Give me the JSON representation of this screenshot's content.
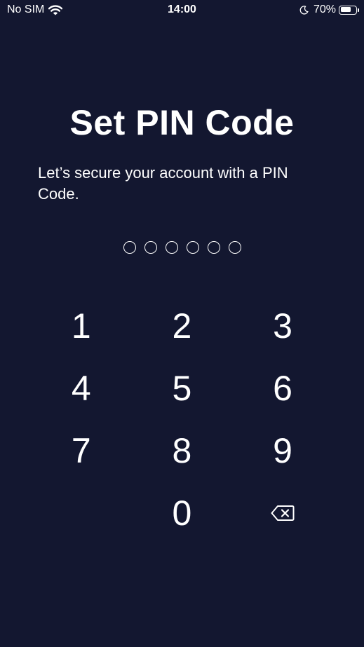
{
  "status_bar": {
    "carrier": "No SIM",
    "time": "14:00",
    "battery_percent": "70%",
    "battery_level": 0.7
  },
  "screen": {
    "title": "Set PIN Code",
    "subtitle": "Let’s secure your account with a PIN Code.",
    "pin_length": 6,
    "pin_filled": 0
  },
  "keypad": {
    "keys": [
      "1",
      "2",
      "3",
      "4",
      "5",
      "6",
      "7",
      "8",
      "9",
      "",
      "0",
      "backspace"
    ]
  },
  "colors": {
    "background": "#131730",
    "text": "#ffffff"
  },
  "icons": {
    "wifi": "wifi-icon",
    "moon": "moon-icon",
    "battery": "battery-icon",
    "backspace": "backspace-icon"
  }
}
